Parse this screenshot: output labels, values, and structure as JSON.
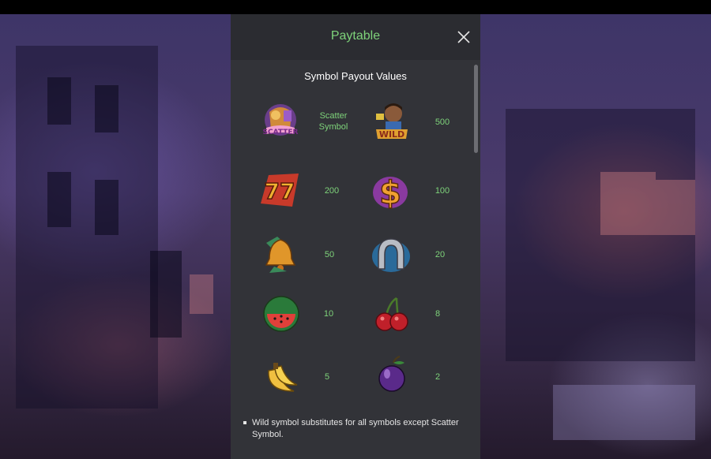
{
  "panel": {
    "title": "Paytable",
    "section_title": "Symbol Payout Values"
  },
  "symbols": [
    {
      "name": "Scatter",
      "payout": "Scatter Symbol",
      "logo_text": "SCATTER"
    },
    {
      "name": "Wild",
      "payout": "500",
      "logo_text": "WILD"
    },
    {
      "name": "Sevens",
      "payout": "200",
      "logo_text": "77"
    },
    {
      "name": "Dollar",
      "payout": "100",
      "logo_text": "$"
    },
    {
      "name": "Bell",
      "payout": "50"
    },
    {
      "name": "Horseshoe",
      "payout": "20"
    },
    {
      "name": "Watermelon",
      "payout": "10"
    },
    {
      "name": "Cherries",
      "payout": "8"
    },
    {
      "name": "Banana",
      "payout": "5"
    },
    {
      "name": "Plum",
      "payout": "2"
    }
  ],
  "rules": [
    "Wild symbol substitutes for all symbols except Scatter Symbol."
  ],
  "colors": {
    "accent_green": "#7ed37a",
    "panel_bg": "#2b2c31",
    "content_bg": "#323338"
  },
  "icons": {
    "close": "close-icon"
  }
}
